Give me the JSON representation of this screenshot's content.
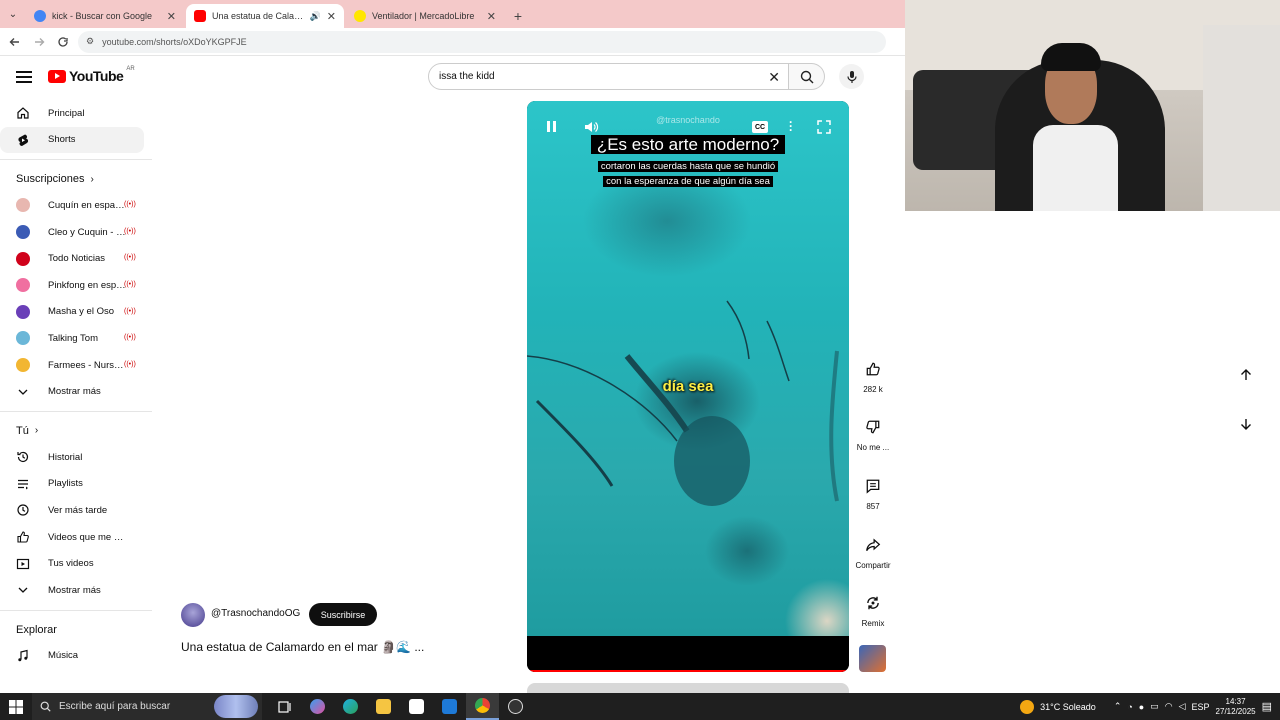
{
  "browser": {
    "tabs": [
      {
        "title": "kick - Buscar con Google",
        "active": false,
        "favicon_color": "#4285f4"
      },
      {
        "title": "Una estatua de Calamardo",
        "active": true,
        "favicon_color": "#ff0000"
      },
      {
        "title": "Ventilador | MercadoLibre",
        "active": false,
        "favicon_color": "#ffe600"
      }
    ],
    "url": "youtube.com/shorts/oXDoYKGPFJE"
  },
  "youtube": {
    "logo_text": "YouTube",
    "country_code": "AR",
    "search_value": "issa the kidd"
  },
  "sidebar": {
    "main": [
      {
        "label": "Principal",
        "icon": "home-icon"
      },
      {
        "label": "Shorts",
        "icon": "shorts-icon",
        "active": true
      }
    ],
    "subscriptions_title": "Suscripciones",
    "subscriptions": [
      {
        "label": "Cuquín en españ...",
        "color": "#e8b7b0",
        "live": true
      },
      {
        "label": "Cleo y Cuquin - C...",
        "color": "#3b5bb5",
        "live": true
      },
      {
        "label": "Todo Noticias",
        "color": "#d0021b",
        "live": true
      },
      {
        "label": "Pinkfong en espa...",
        "color": "#f06fa0",
        "live": true
      },
      {
        "label": "Masha y el Oso",
        "color": "#6a3fb8",
        "live": true
      },
      {
        "label": "Talking Tom",
        "color": "#6bb7d8",
        "live": true
      },
      {
        "label": "Farmees - Nurser...",
        "color": "#f2b632",
        "live": true
      }
    ],
    "show_more": "Mostrar más",
    "you_title": "Tú",
    "you": [
      {
        "label": "Historial",
        "icon": "history-icon"
      },
      {
        "label": "Playlists",
        "icon": "playlists-icon"
      },
      {
        "label": "Ver más tarde",
        "icon": "watch-later-icon"
      },
      {
        "label": "Videos que me gust...",
        "icon": "like-icon"
      },
      {
        "label": "Tus videos",
        "icon": "your-videos-icon"
      }
    ],
    "show_more_2": "Mostrar más",
    "explore_title": "Explorar",
    "explore": [
      {
        "label": "Música",
        "icon": "music-icon"
      }
    ]
  },
  "player": {
    "watermark": "@trasnochando",
    "caption_title": "¿Es esto arte moderno?",
    "caption_line1": "cortaron las cuerdas hasta que se hundió",
    "caption_line2": "con la esperanza de que algún día sea",
    "caption_center": "día sea",
    "progress_fraction": 0.99
  },
  "channel": {
    "handle": "@TrasnochandoOG",
    "subscribe_label": "Suscribirse",
    "video_title": "Una estatua de Calamardo en el mar 🗿🌊 ..."
  },
  "actions": {
    "likes": "282 k",
    "dislike_label": "No me ...",
    "comments": "857",
    "share_label": "Compartir",
    "remix_label": "Remix"
  },
  "taskbar": {
    "search_placeholder": "Escribe aquí para buscar",
    "weather": "31°C  Soleado",
    "language": "ESP",
    "time": "14:37",
    "date": "27/12/2025"
  }
}
